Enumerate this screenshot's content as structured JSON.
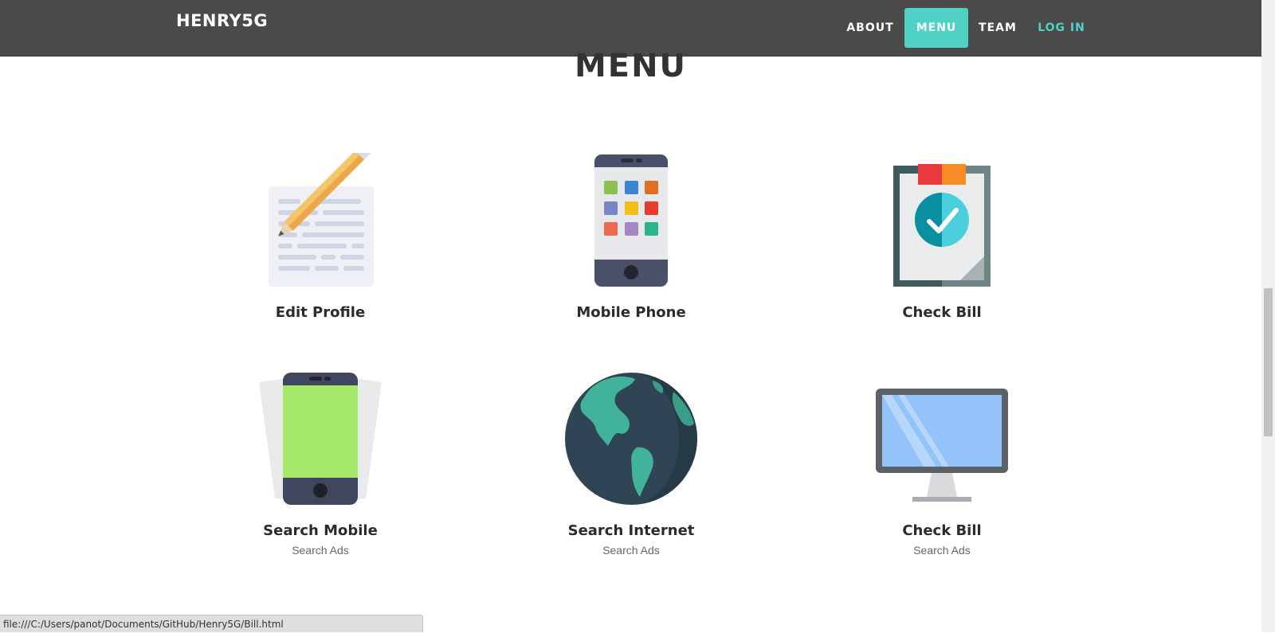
{
  "navbar": {
    "brand": "HENRY5G",
    "items": [
      {
        "label": "ABOUT"
      },
      {
        "label": "MENU",
        "active": true
      },
      {
        "label": "TEAM"
      },
      {
        "label": "LOG IN"
      }
    ],
    "colors": {
      "background": "#4a4a4a",
      "accent": "#4fd1c5"
    }
  },
  "section": {
    "title": "MENU"
  },
  "cards": [
    {
      "label": "Edit Profile",
      "icon": "edit-document-icon"
    },
    {
      "label": "Mobile Phone",
      "icon": "mobile-phone-icon"
    },
    {
      "label": "Check Bill",
      "icon": "clipboard-check-icon"
    },
    {
      "label": "Search Mobile",
      "sub": "Search Ads",
      "icon": "green-phone-icon"
    },
    {
      "label": "Search Internet",
      "sub": "Search Ads",
      "icon": "globe-icon"
    },
    {
      "label": "Check Bill",
      "sub": "Search Ads",
      "icon": "monitor-icon"
    }
  ],
  "status_bar": {
    "url": "file:///C:/Users/panot/Documents/GitHub/Henry5G/Bill.html"
  }
}
